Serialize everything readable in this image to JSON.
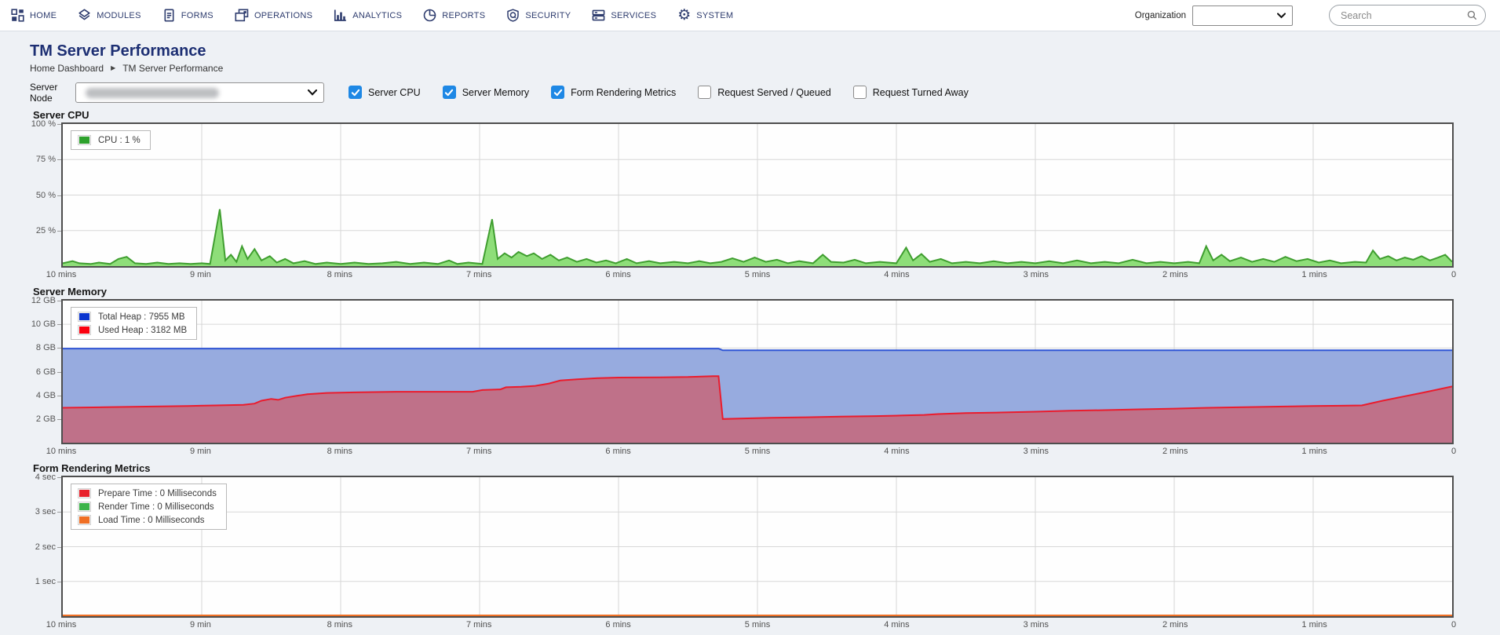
{
  "nav": {
    "items": [
      {
        "label": "HOME",
        "icon": "dashboard-icon"
      },
      {
        "label": "MODULES",
        "icon": "modules-icon"
      },
      {
        "label": "FORMS",
        "icon": "forms-icon"
      },
      {
        "label": "OPERATIONS",
        "icon": "operations-icon"
      },
      {
        "label": "ANALYTICS",
        "icon": "analytics-icon"
      },
      {
        "label": "REPORTS",
        "icon": "reports-icon"
      },
      {
        "label": "SECURITY",
        "icon": "security-icon"
      },
      {
        "label": "SERVICES",
        "icon": "services-icon"
      },
      {
        "label": "SYSTEM",
        "icon": "system-gear-icon"
      }
    ],
    "organization_label": "Organization",
    "organization_value": "",
    "search_placeholder": "Search"
  },
  "icons": {
    "system_gear": "⚙",
    "breadcrumb_arrow": "▶"
  },
  "page": {
    "title": "TM Server Performance",
    "breadcrumb": [
      "Home Dashboard",
      "TM Server Performance"
    ]
  },
  "filters": {
    "server_node_label": "Server Node",
    "server_node_value_redacted": true,
    "checkbox_accent": "#1e88e5",
    "checkboxes": [
      {
        "label": "Server CPU",
        "checked": true
      },
      {
        "label": "Server Memory",
        "checked": true
      },
      {
        "label": "Form Rendering Metrics",
        "checked": true
      },
      {
        "label": "Request Served / Queued",
        "checked": false
      },
      {
        "label": "Request Turned Away",
        "checked": false
      }
    ]
  },
  "chart_data": [
    {
      "type": "area",
      "title": "Server CPU",
      "ylim": [
        0,
        100
      ],
      "yticks": [
        {
          "v": 100,
          "label": "100 %"
        },
        {
          "v": 75,
          "label": "75 %"
        },
        {
          "v": 50,
          "label": "50 %"
        },
        {
          "v": 25,
          "label": "25 %"
        }
      ],
      "xticks": [
        "10 mins",
        "9 min",
        "8 mins",
        "7 mins",
        "6 mins",
        "5 mins",
        "4 mins",
        "3 mins",
        "2 mins",
        "1 mins",
        "0"
      ],
      "grid": true,
      "legend_position": "top-left",
      "legend": [
        {
          "label": "CPU : 1 %",
          "color": "#2da12c"
        }
      ],
      "series": [
        {
          "name": "CPU",
          "stroke": "#3f9e2f",
          "fill": "#8ede79",
          "points": [
            [
              0,
              2
            ],
            [
              0.7,
              3.5
            ],
            [
              1.2,
              2
            ],
            [
              2,
              1.5
            ],
            [
              2.6,
              2.5
            ],
            [
              3.4,
              1.5
            ],
            [
              4,
              5
            ],
            [
              4.6,
              6.5
            ],
            [
              5.2,
              2
            ],
            [
              6,
              1.5
            ],
            [
              6.8,
              2.5
            ],
            [
              7.6,
              1.5
            ],
            [
              8.4,
              2
            ],
            [
              9.2,
              1.5
            ],
            [
              10,
              2
            ],
            [
              10.6,
              1.5
            ],
            [
              11.3,
              40
            ],
            [
              11.7,
              4
            ],
            [
              12.1,
              8
            ],
            [
              12.5,
              3
            ],
            [
              12.9,
              14
            ],
            [
              13.3,
              5
            ],
            [
              13.8,
              12
            ],
            [
              14.3,
              4
            ],
            [
              14.9,
              7
            ],
            [
              15.4,
              2.5
            ],
            [
              16,
              5
            ],
            [
              16.6,
              2
            ],
            [
              17.4,
              3.5
            ],
            [
              18.2,
              1.5
            ],
            [
              19,
              2.5
            ],
            [
              20,
              1.5
            ],
            [
              21,
              2.5
            ],
            [
              22,
              1.5
            ],
            [
              23,
              2
            ],
            [
              24,
              3
            ],
            [
              25,
              1.5
            ],
            [
              26,
              2.5
            ],
            [
              27,
              1.5
            ],
            [
              27.8,
              4
            ],
            [
              28.4,
              1.5
            ],
            [
              29.2,
              2.5
            ],
            [
              30.2,
              1.5
            ],
            [
              30.9,
              33
            ],
            [
              31.3,
              5
            ],
            [
              31.8,
              9
            ],
            [
              32.3,
              6
            ],
            [
              32.8,
              10
            ],
            [
              33.4,
              7
            ],
            [
              33.9,
              9
            ],
            [
              34.5,
              5
            ],
            [
              35.1,
              8
            ],
            [
              35.7,
              4
            ],
            [
              36.3,
              6
            ],
            [
              37,
              3
            ],
            [
              37.7,
              5
            ],
            [
              38.4,
              2.5
            ],
            [
              39.1,
              4
            ],
            [
              39.8,
              2
            ],
            [
              40.6,
              5
            ],
            [
              41.3,
              2
            ],
            [
              42.2,
              3.5
            ],
            [
              43,
              2
            ],
            [
              44,
              3
            ],
            [
              45,
              2
            ],
            [
              45.8,
              3.5
            ],
            [
              46.6,
              2
            ],
            [
              47.4,
              3
            ],
            [
              48.2,
              5.5
            ],
            [
              49,
              3
            ],
            [
              49.8,
              6
            ],
            [
              50.6,
              3
            ],
            [
              51.4,
              4.5
            ],
            [
              52.2,
              2
            ],
            [
              53,
              3.5
            ],
            [
              54,
              2
            ],
            [
              54.7,
              8
            ],
            [
              55.3,
              3
            ],
            [
              56.2,
              2.5
            ],
            [
              57,
              4.5
            ],
            [
              57.8,
              2
            ],
            [
              58.8,
              3
            ],
            [
              60,
              2
            ],
            [
              60.7,
              13
            ],
            [
              61.2,
              4
            ],
            [
              61.8,
              8.5
            ],
            [
              62.4,
              3
            ],
            [
              63.2,
              5
            ],
            [
              64,
              2
            ],
            [
              65,
              3
            ],
            [
              66,
              2
            ],
            [
              67,
              3.5
            ],
            [
              68,
              2
            ],
            [
              69,
              3
            ],
            [
              70,
              2
            ],
            [
              71,
              3.5
            ],
            [
              72,
              2
            ],
            [
              73,
              4
            ],
            [
              74,
              2
            ],
            [
              75,
              3
            ],
            [
              76,
              2
            ],
            [
              77,
              4.5
            ],
            [
              78,
              2
            ],
            [
              79,
              3
            ],
            [
              80,
              2
            ],
            [
              81,
              3
            ],
            [
              81.8,
              2
            ],
            [
              82.3,
              14
            ],
            [
              82.8,
              4
            ],
            [
              83.4,
              8
            ],
            [
              84,
              3.5
            ],
            [
              84.8,
              6
            ],
            [
              85.6,
              3
            ],
            [
              86.4,
              5
            ],
            [
              87.2,
              3
            ],
            [
              88,
              6.5
            ],
            [
              88.8,
              3.5
            ],
            [
              89.6,
              5
            ],
            [
              90.4,
              2.5
            ],
            [
              91.2,
              4
            ],
            [
              92,
              2
            ],
            [
              93,
              3
            ],
            [
              93.8,
              2.5
            ],
            [
              94.3,
              11
            ],
            [
              94.8,
              5
            ],
            [
              95.4,
              7
            ],
            [
              96,
              4
            ],
            [
              96.6,
              6
            ],
            [
              97.2,
              4.5
            ],
            [
              97.8,
              7
            ],
            [
              98.4,
              4
            ],
            [
              99,
              6
            ],
            [
              99.5,
              8
            ],
            [
              100,
              3
            ]
          ]
        }
      ]
    },
    {
      "type": "area",
      "title": "Server Memory",
      "ylim": [
        0,
        12
      ],
      "yticks": [
        {
          "v": 12,
          "label": "12 GB"
        },
        {
          "v": 10,
          "label": "10 GB"
        },
        {
          "v": 8,
          "label": "8 GB"
        },
        {
          "v": 6,
          "label": "6 GB"
        },
        {
          "v": 4,
          "label": "4 GB"
        },
        {
          "v": 2,
          "label": "2 GB"
        }
      ],
      "xticks": [
        "10 mins",
        "9 min",
        "8 mins",
        "7 mins",
        "6 mins",
        "5 mins",
        "4 mins",
        "3 mins",
        "2 mins",
        "1 mins",
        "0"
      ],
      "grid": true,
      "legend_position": "top-left",
      "legend": [
        {
          "label": "Total Heap : 7955 MB",
          "color": "#0b35cf"
        },
        {
          "label": "Used Heap : 3182 MB",
          "color": "#fb0210"
        }
      ],
      "series": [
        {
          "name": "Total Heap",
          "stroke": "#2f55d6",
          "fill": "#97abdf",
          "points": [
            [
              0,
              7.95
            ],
            [
              47.2,
              7.95
            ],
            [
              47.5,
              7.8
            ],
            [
              100,
              7.8
            ]
          ]
        },
        {
          "name": "Used Heap",
          "stroke": "#ea1c2d",
          "fill": "#bf7189",
          "points": [
            [
              0,
              2.95
            ],
            [
              3,
              3.0
            ],
            [
              6,
              3.05
            ],
            [
              9,
              3.1
            ],
            [
              11,
              3.15
            ],
            [
              13,
              3.2
            ],
            [
              13.8,
              3.3
            ],
            [
              14.3,
              3.55
            ],
            [
              15,
              3.7
            ],
            [
              15.5,
              3.62
            ],
            [
              16,
              3.8
            ],
            [
              16.8,
              3.95
            ],
            [
              17.6,
              4.1
            ],
            [
              19,
              4.2
            ],
            [
              21,
              4.25
            ],
            [
              24,
              4.3
            ],
            [
              28,
              4.3
            ],
            [
              29.5,
              4.3
            ],
            [
              30.2,
              4.45
            ],
            [
              31.5,
              4.5
            ],
            [
              31.9,
              4.68
            ],
            [
              33,
              4.72
            ],
            [
              34,
              4.8
            ],
            [
              35,
              5.0
            ],
            [
              35.8,
              5.25
            ],
            [
              37,
              5.35
            ],
            [
              38.5,
              5.45
            ],
            [
              40,
              5.5
            ],
            [
              43,
              5.52
            ],
            [
              45,
              5.55
            ],
            [
              46.8,
              5.62
            ],
            [
              47.2,
              5.62
            ],
            [
              47.5,
              2.0
            ],
            [
              49,
              2.05
            ],
            [
              51,
              2.1
            ],
            [
              53.5,
              2.15
            ],
            [
              56,
              2.2
            ],
            [
              58.5,
              2.25
            ],
            [
              60.5,
              2.3
            ],
            [
              62,
              2.35
            ],
            [
              63,
              2.42
            ],
            [
              65,
              2.5
            ],
            [
              67.5,
              2.55
            ],
            [
              70,
              2.62
            ],
            [
              72.5,
              2.7
            ],
            [
              75,
              2.75
            ],
            [
              77.5,
              2.82
            ],
            [
              80,
              2.88
            ],
            [
              82.5,
              2.95
            ],
            [
              85,
              3.0
            ],
            [
              87.5,
              3.05
            ],
            [
              90,
              3.1
            ],
            [
              92,
              3.12
            ],
            [
              93.5,
              3.15
            ],
            [
              95,
              3.55
            ],
            [
              96.5,
              3.9
            ],
            [
              98,
              4.25
            ],
            [
              100,
              4.75
            ]
          ]
        }
      ]
    },
    {
      "type": "line",
      "title": "Form Rendering Metrics",
      "ylim": [
        0,
        4
      ],
      "yticks": [
        {
          "v": 4,
          "label": "4 sec"
        },
        {
          "v": 3,
          "label": "3 sec"
        },
        {
          "v": 2,
          "label": "2 sec"
        },
        {
          "v": 1,
          "label": "1 sec"
        }
      ],
      "xticks": [
        "10 mins",
        "9 min",
        "8 mins",
        "7 mins",
        "6 mins",
        "5 mins",
        "4 mins",
        "3 mins",
        "2 mins",
        "1 mins",
        "0"
      ],
      "grid": true,
      "legend_position": "top-left",
      "legend": [
        {
          "label": "Prepare Time : 0 Milliseconds",
          "color": "#e8212b"
        },
        {
          "label": "Render Time : 0 Milliseconds",
          "color": "#3cb449"
        },
        {
          "label": "Load Time : 0 Milliseconds",
          "color": "#f07025"
        }
      ],
      "series": [
        {
          "name": "Prepare Time",
          "stroke": "#b5433c",
          "fill": null,
          "points": [
            [
              0,
              0
            ],
            [
              100,
              0
            ]
          ]
        },
        {
          "name": "Render Time",
          "stroke": "#3cb449",
          "fill": null,
          "points": [
            [
              0,
              0
            ],
            [
              100,
              0
            ]
          ]
        },
        {
          "name": "Load Time",
          "stroke": "#f07025",
          "fill": null,
          "points": [
            [
              0,
              0
            ],
            [
              100,
              0
            ]
          ]
        }
      ]
    }
  ]
}
